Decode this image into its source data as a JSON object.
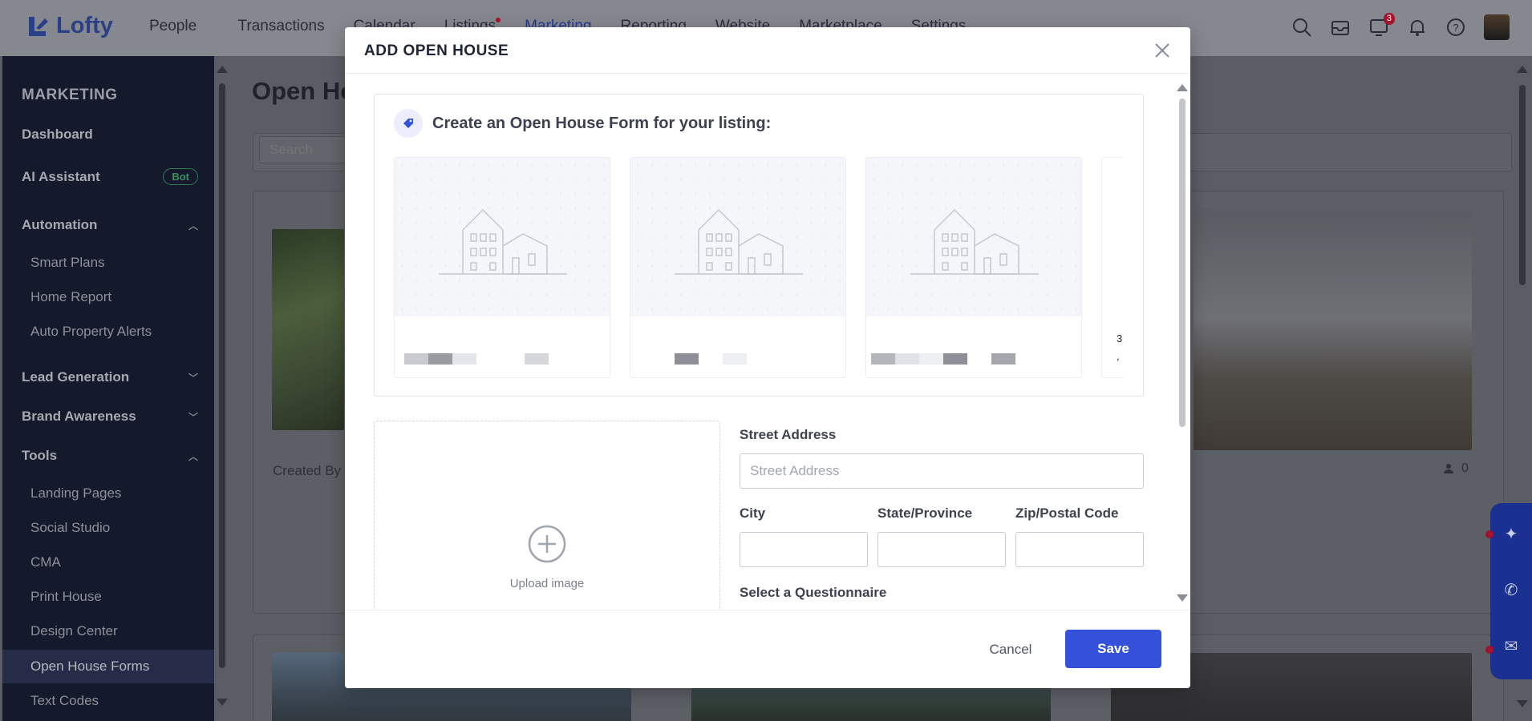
{
  "app": {
    "logo_text": "Lofty",
    "nav": [
      "People",
      "Transactions",
      "Calendar",
      "Listings",
      "Marketing",
      "Reporting",
      "Website",
      "Marketplace",
      "Settings"
    ],
    "notification_count": "3"
  },
  "sidebar": {
    "section_title": "MARKETING",
    "dashboard": "Dashboard",
    "ai_assistant": "AI Assistant",
    "bot_badge": "Bot",
    "automation": "Automation",
    "automation_items": [
      "Smart Plans",
      "Home Report",
      "Auto Property Alerts"
    ],
    "lead_generation": "Lead Generation",
    "brand_awareness": "Brand Awareness",
    "tools": "Tools",
    "tools_items": [
      "Landing Pages",
      "Social Studio",
      "CMA",
      "Print House",
      "Design Center",
      "Open House Forms",
      "Text Codes"
    ]
  },
  "page": {
    "title": "Open Ho",
    "search_placeholder": "Search",
    "created_by": "Created By",
    "view_count": "0"
  },
  "modal": {
    "title": "ADD OPEN HOUSE",
    "listing_heading": "Create an Open House Form for your listing:",
    "partial_listing_text_1": "3",
    "partial_listing_text_2": ", ",
    "upload_label": "Upload image",
    "street_label": "Street Address",
    "street_placeholder": "Street Address",
    "city_label": "City",
    "state_label": "State/Province",
    "zip_label": "Zip/Postal Code",
    "questionnaire_label": "Select a Questionnaire",
    "cancel": "Cancel",
    "save": "Save"
  },
  "colors": {
    "accent": "#3351d9",
    "sidebar_bg": "#141a2c",
    "overlay": "#5b5d66"
  }
}
